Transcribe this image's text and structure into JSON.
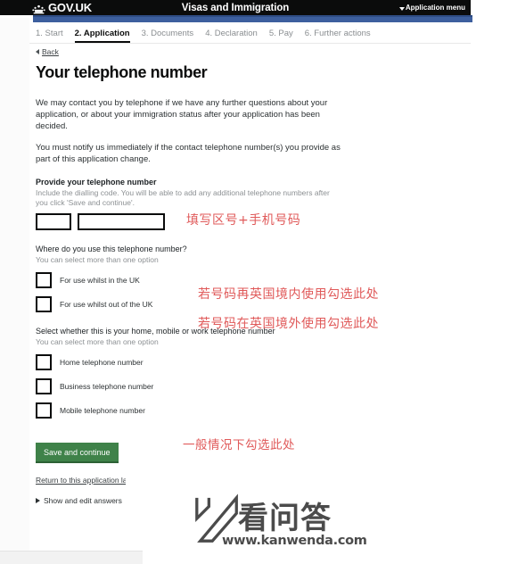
{
  "header": {
    "crown_icon": "crown-icon",
    "brand": "GOV.UK",
    "service_title": "Visas and Immigration",
    "application_menu": "Application menu",
    "menu_caret_icon": "chevron-down-icon"
  },
  "steps": [
    {
      "label": "1. Start",
      "current": false
    },
    {
      "label": "2. Application",
      "current": true
    },
    {
      "label": "3. Documents",
      "current": false
    },
    {
      "label": "4. Declaration",
      "current": false
    },
    {
      "label": "5. Pay",
      "current": false
    },
    {
      "label": "6. Further actions",
      "current": false
    }
  ],
  "back": {
    "label": "Back",
    "icon": "caret-left-icon"
  },
  "page_title": "Your telephone number",
  "paragraphs": [
    "We may contact you by telephone if we have any further questions about your application, or about your immigration status after your application has been decided.",
    "You must notify us immediately if the contact telephone number(s) you provide as part of this application change."
  ],
  "telephone_field": {
    "label": "Provide your telephone number",
    "hint": "Include the dialling code. You will be able to add any additional telephone numbers after you click 'Save and continue'.",
    "dialling_code_value": "",
    "dialling_code_placeholder": "",
    "number_value": "",
    "number_placeholder": ""
  },
  "where_group": {
    "legend": "Where do you use this telephone number?",
    "hint": "You can select more than one option",
    "options": [
      {
        "label": "For use whilst in the UK",
        "checked": false
      },
      {
        "label": "For use whilst out of the UK",
        "checked": false
      }
    ]
  },
  "type_group": {
    "legend": "Select whether this is your home, mobile or work telephone number",
    "hint": "You can select more than one option",
    "options": [
      {
        "label": "Home telephone number",
        "checked": false
      },
      {
        "label": "Business telephone number",
        "checked": false
      },
      {
        "label": "Mobile telephone number",
        "checked": false
      }
    ]
  },
  "actions": {
    "save_label": "Save and continue",
    "return_label": "Return to this application later",
    "show_answers_label": "Show and edit answers",
    "show_answers_icon": "triangle-right-icon"
  },
  "annotations": [
    "填写区号+手机号码",
    "若号码再英国境内使用勾选此处",
    "若号码在英国境外使用勾选此处",
    "一般情况下勾选此处"
  ],
  "watermark": {
    "logo_icon": "kanwenda-k-logo-icon",
    "name": "看问答",
    "url": "www.kanwenda.com"
  },
  "colors": {
    "header_black": "#0b0c0c",
    "phase_blue": "#3d5f9e",
    "button_green": "#3f8249",
    "annotation_red": "#e05a5a",
    "link_grey": "#3a3f42"
  }
}
